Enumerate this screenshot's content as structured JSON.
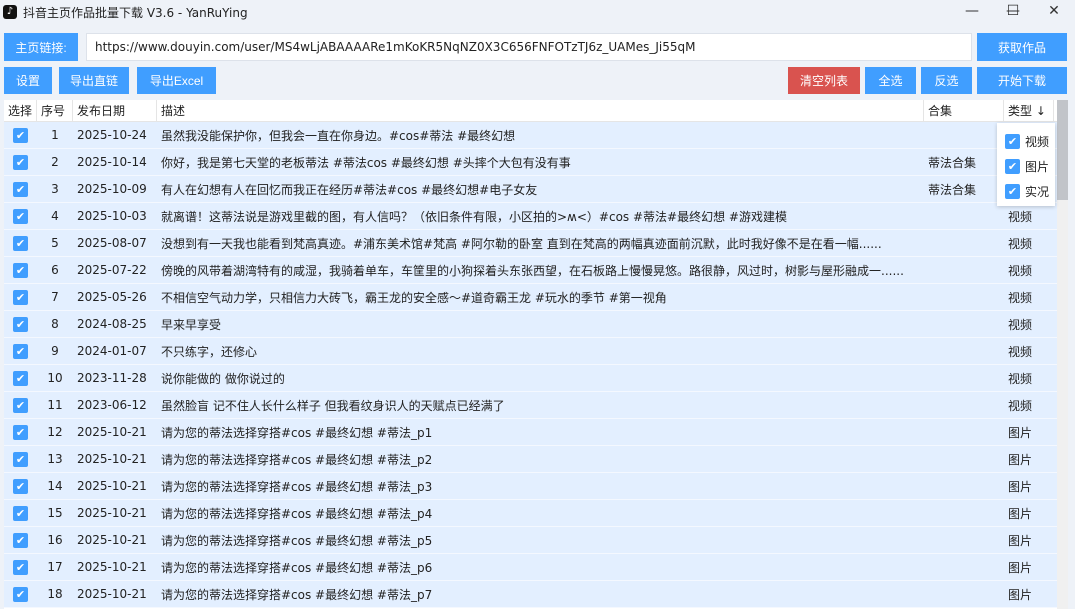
{
  "window": {
    "title": "抖音主页作品批量下载 V3.6 - YanRuYing"
  },
  "toolbar": {
    "url_label": "主页链接:",
    "url_value": "https://www.douyin.com/user/MS4wLjABAAAARe1mKoKR5NqNZ0X3C656FNFOTzTJ6z_UAMes_Ji55qM",
    "fetch": "获取作品",
    "settings": "设置",
    "export_links": "导出直链",
    "export_excel": "导出Excel",
    "clear": "清空列表",
    "select_all": "全选",
    "invert": "反选",
    "download": "开始下载"
  },
  "colors": {
    "primary": "#409eff",
    "danger": "#d9534f"
  },
  "table": {
    "headers": [
      "选择",
      "序号",
      "发布日期",
      "描述",
      "合集",
      "类型 ↓"
    ],
    "rows": [
      [
        "1",
        "2025-10-24",
        "虽然我没能保护你，但我会一直在你身边。#cos#蒂法 #最终幻想",
        "",
        ""
      ],
      [
        "2",
        "2025-10-14",
        "你好，我是第七天堂的老板蒂法 #蒂法cos #最终幻想 #头摔个大包有没有事",
        "蒂法合集",
        ""
      ],
      [
        "3",
        "2025-10-09",
        "有人在幻想有人在回忆而我正在经历#蒂法#cos #最终幻想#电子女友",
        "蒂法合集",
        ""
      ],
      [
        "4",
        "2025-10-03",
        "就离谱！这蒂法说是游戏里截的图，有人信吗？（依旧条件有限，小区拍的>ʍ<）#cos #蒂法#最终幻想 #游戏建模",
        "",
        "视频"
      ],
      [
        "5",
        "2025-08-07",
        "没想到有一天我也能看到梵高真迹。#浦东美术馆#梵高 #阿尔勒的卧室 直到在梵高的两幅真迹面前沉默，此时我好像不是在看一幅......",
        "",
        "视频"
      ],
      [
        "6",
        "2025-07-22",
        "傍晚的风带着湖湾特有的咸湿，我骑着单车，车筐里的小狗探着头东张西望，在石板路上慢慢晃悠。路很静，风过时，树影与屋形融成一......",
        "",
        "视频"
      ],
      [
        "7",
        "2025-05-26",
        "不相信空气动力学，只相信力大砖飞，霸王龙的安全感～#道奇霸王龙 #玩水的季节 #第一视角",
        "",
        "视频"
      ],
      [
        "8",
        "2024-08-25",
        "早来早享受",
        "",
        "视频"
      ],
      [
        "9",
        "2024-01-07",
        "不只练字，还修心",
        "",
        "视频"
      ],
      [
        "10",
        "2023-11-28",
        "说你能做的 做你说过的",
        "",
        "视频"
      ],
      [
        "11",
        "2023-06-12",
        "虽然脸盲 记不住人长什么样子 但我看纹身识人的天赋点已经满了",
        "",
        "视频"
      ],
      [
        "12",
        "2025-10-21",
        "请为您的蒂法选择穿搭#cos #最终幻想 #蒂法_p1",
        "",
        "图片"
      ],
      [
        "13",
        "2025-10-21",
        "请为您的蒂法选择穿搭#cos #最终幻想 #蒂法_p2",
        "",
        "图片"
      ],
      [
        "14",
        "2025-10-21",
        "请为您的蒂法选择穿搭#cos #最终幻想 #蒂法_p3",
        "",
        "图片"
      ],
      [
        "15",
        "2025-10-21",
        "请为您的蒂法选择穿搭#cos #最终幻想 #蒂法_p4",
        "",
        "图片"
      ],
      [
        "16",
        "2025-10-21",
        "请为您的蒂法选择穿搭#cos #最终幻想 #蒂法_p5",
        "",
        "图片"
      ],
      [
        "17",
        "2025-10-21",
        "请为您的蒂法选择穿搭#cos #最终幻想 #蒂法_p6",
        "",
        "图片"
      ],
      [
        "18",
        "2025-10-21",
        "请为您的蒂法选择穿搭#cos #最终幻想 #蒂法_p7",
        "",
        "图片"
      ]
    ]
  },
  "type_filter": [
    "视频",
    "图片",
    "实况"
  ]
}
